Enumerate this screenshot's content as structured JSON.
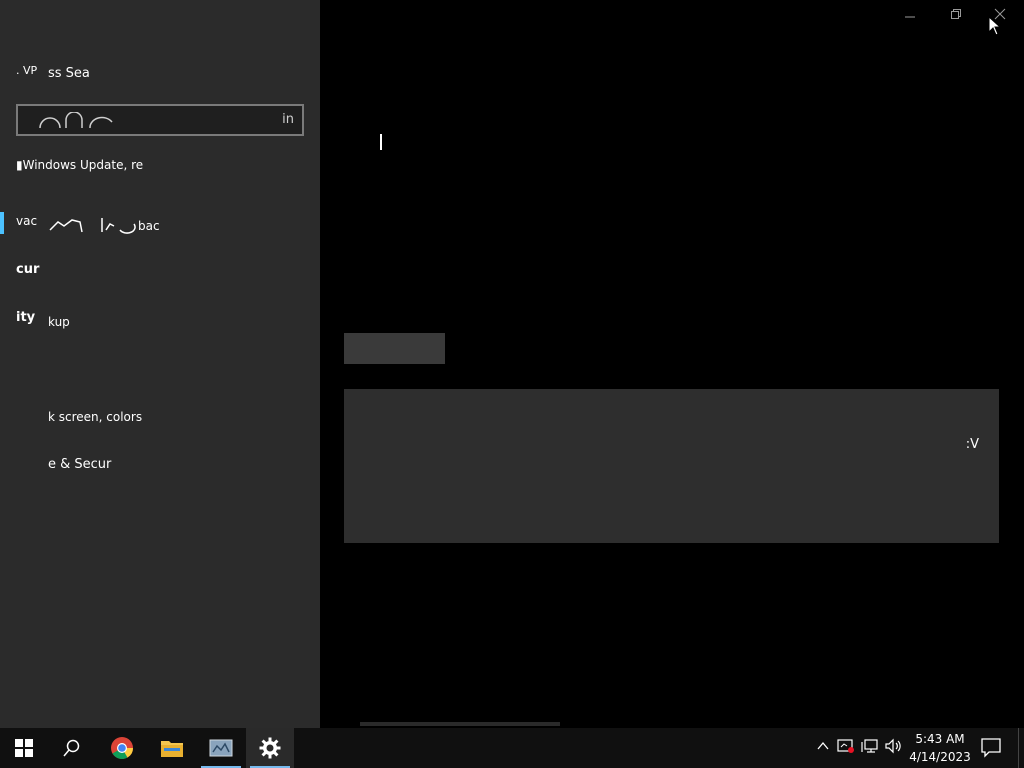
{
  "sidebar": {
    "row1_left": ". VP",
    "row1_right": "ss Sea",
    "search_hint": "in",
    "update_text": "Windows Update, re",
    "row4_left": "vac",
    "row4_right": "bac",
    "row5_left": "cur",
    "row6_left": "ity",
    "row6_right": "kup",
    "lock_text": "k screen, colors",
    "secur_text": "e & Secur"
  },
  "main": {
    "panel_text": ":V"
  },
  "taskbar": {
    "time": "5:43 AM",
    "date": "4/14/2023"
  },
  "colors": {
    "accent": "#4cc2ff",
    "taskbar_bg": "#101010",
    "sidebar_bg": "#2b2b2b"
  }
}
